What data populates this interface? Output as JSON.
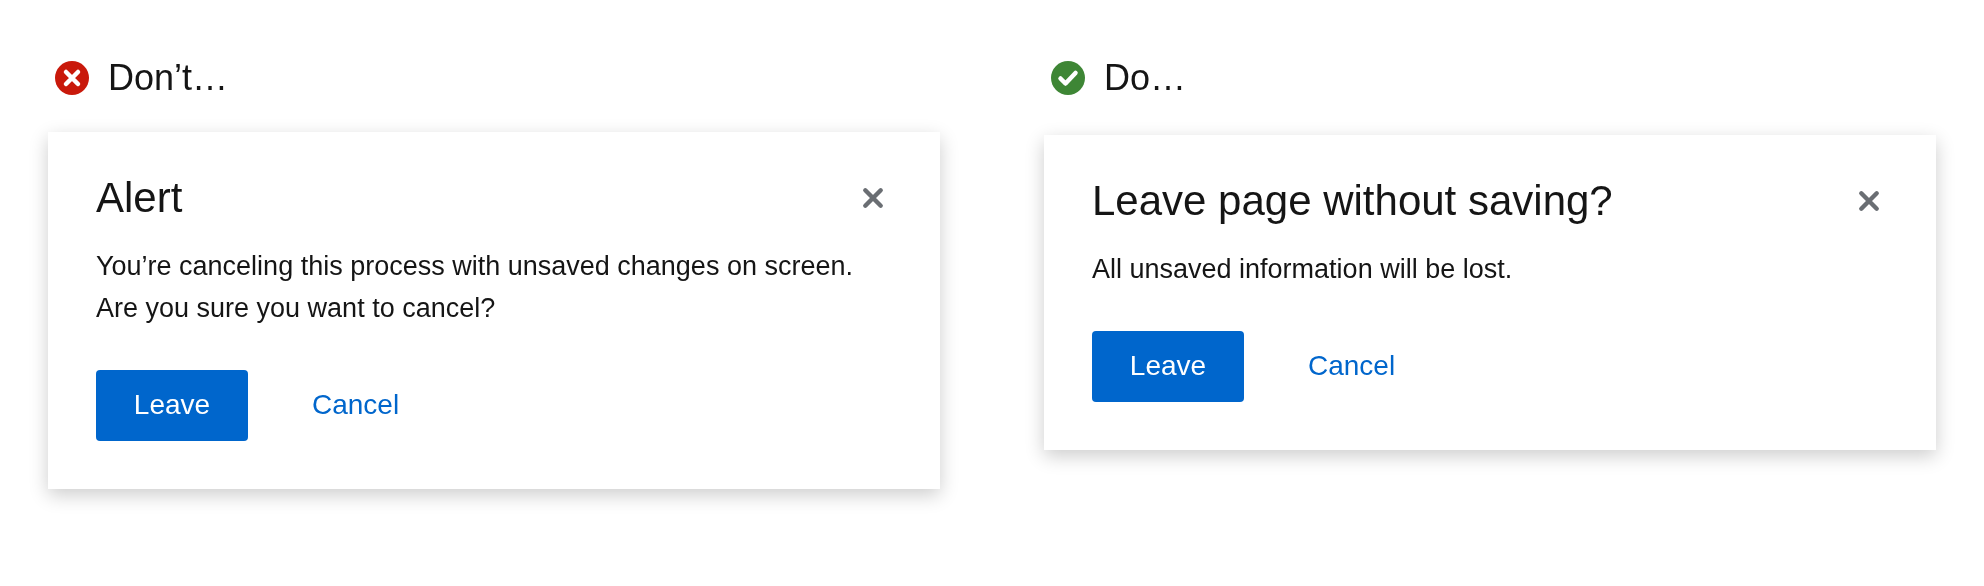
{
  "examples": [
    {
      "kind": "dont",
      "heading": "Don’t…",
      "dialog": {
        "title": "Alert",
        "body": "You’re canceling this process with unsaved changes on screen. Are you sure you want to cancel?",
        "primary_button": "Leave",
        "link_button": "Cancel"
      }
    },
    {
      "kind": "do",
      "heading": "Do…",
      "dialog": {
        "title": "Leave page without saving?",
        "body": "All unsaved information will be lost.",
        "primary_button": "Leave",
        "link_button": "Cancel"
      }
    }
  ]
}
